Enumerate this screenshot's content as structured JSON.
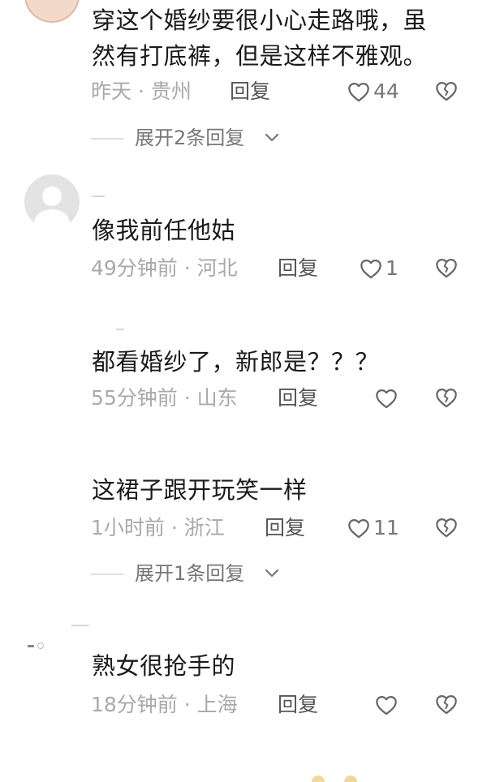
{
  "comments": [
    {
      "text_line1": "穿这个婚纱要很小心走路哦，虽",
      "text_line2": "然有打底裤，但是这样不雅观。",
      "time": "昨天",
      "location": "贵州",
      "reply_label": "回复",
      "likes": "44",
      "expand_label": "展开2条回复"
    },
    {
      "text": "像我前任他姑",
      "time": "49分钟前",
      "location": "河北",
      "reply_label": "回复",
      "likes": "1"
    },
    {
      "text": "都看婚纱了，新郎是？？？",
      "time": "55分钟前",
      "location": "山东",
      "reply_label": "回复",
      "likes": ""
    },
    {
      "text": "这裙子跟开玩笑一样",
      "time": "1小时前",
      "location": "浙江",
      "reply_label": "回复",
      "likes": "11",
      "expand_label": "展开1条回复"
    },
    {
      "text": "熟女很抢手的",
      "time": "18分钟前",
      "location": "上海",
      "reply_label": "回复",
      "likes": ""
    }
  ],
  "meta_separator": "·",
  "icons": {
    "like": "heart-outline-icon",
    "dislike": "broken-heart-icon",
    "expand": "chevron-down-icon"
  },
  "colors": {
    "text": "#1a1a1a",
    "meta": "#a9a9a9",
    "reply": "#555555",
    "icon": "#666666"
  }
}
